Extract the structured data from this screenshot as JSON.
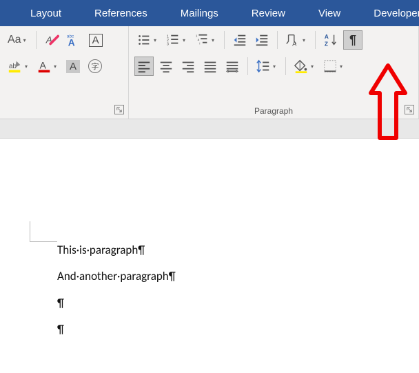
{
  "tabs": [
    "Layout",
    "References",
    "Mailings",
    "Review",
    "View",
    "Developer"
  ],
  "group_font": {
    "launcher": true
  },
  "group_paragraph": {
    "label": "Paragraph",
    "launcher": true
  },
  "doc": {
    "lines": [
      "This·is·paragraph¶",
      "And·another·paragraph¶",
      "¶",
      "¶"
    ]
  },
  "icons": {
    "case": "Aa",
    "clear_format": "A",
    "char_border": "A",
    "pilcrow": "¶",
    "sort": "AZ",
    "circle_char": "字"
  }
}
